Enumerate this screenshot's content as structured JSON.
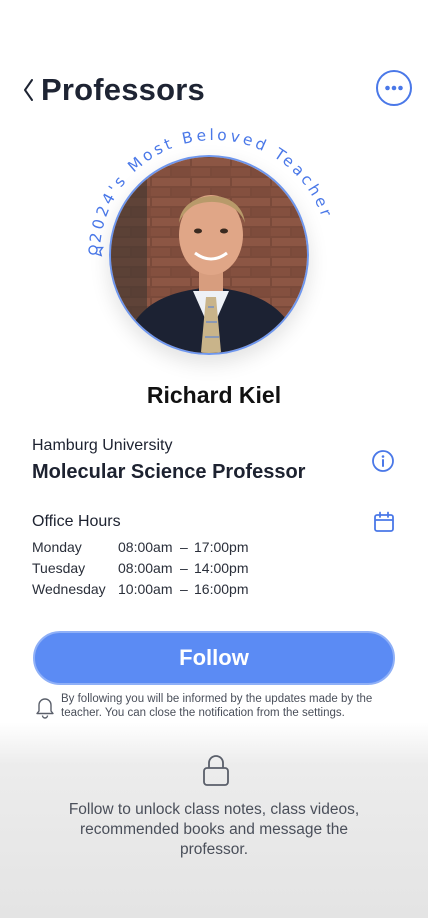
{
  "header": {
    "title": "Professors",
    "back_icon": "chevron-left-icon",
    "more_icon": "more-horizontal-icon"
  },
  "badge": {
    "text": "2024's Most Beloved Teacher",
    "icon": "award-icon",
    "color": "#4a78e8"
  },
  "profile": {
    "name": "Richard Kiel",
    "university": "Hamburg University",
    "role": "Molecular Science Professor"
  },
  "office_hours": {
    "title": "Office Hours",
    "rows": [
      {
        "day": "Monday",
        "start": "08:00am",
        "dash": "–",
        "end": "17:00pm"
      },
      {
        "day": "Tuesday",
        "start": "08:00am",
        "dash": "–",
        "end": "14:00pm"
      },
      {
        "day": "Wednesday",
        "start": "10:00am",
        "dash": "–",
        "end": "16:00pm"
      }
    ]
  },
  "follow": {
    "label": "Follow",
    "notice": "By following you will be informed by the updates made by the teacher. You can close the notification from the settings."
  },
  "locked": {
    "message": "Follow to unlock class notes, class videos, recommended books and message the professor."
  },
  "colors": {
    "accent": "#5b8bf4",
    "accent_border": "#4a78e8",
    "text": "#1d2230"
  }
}
